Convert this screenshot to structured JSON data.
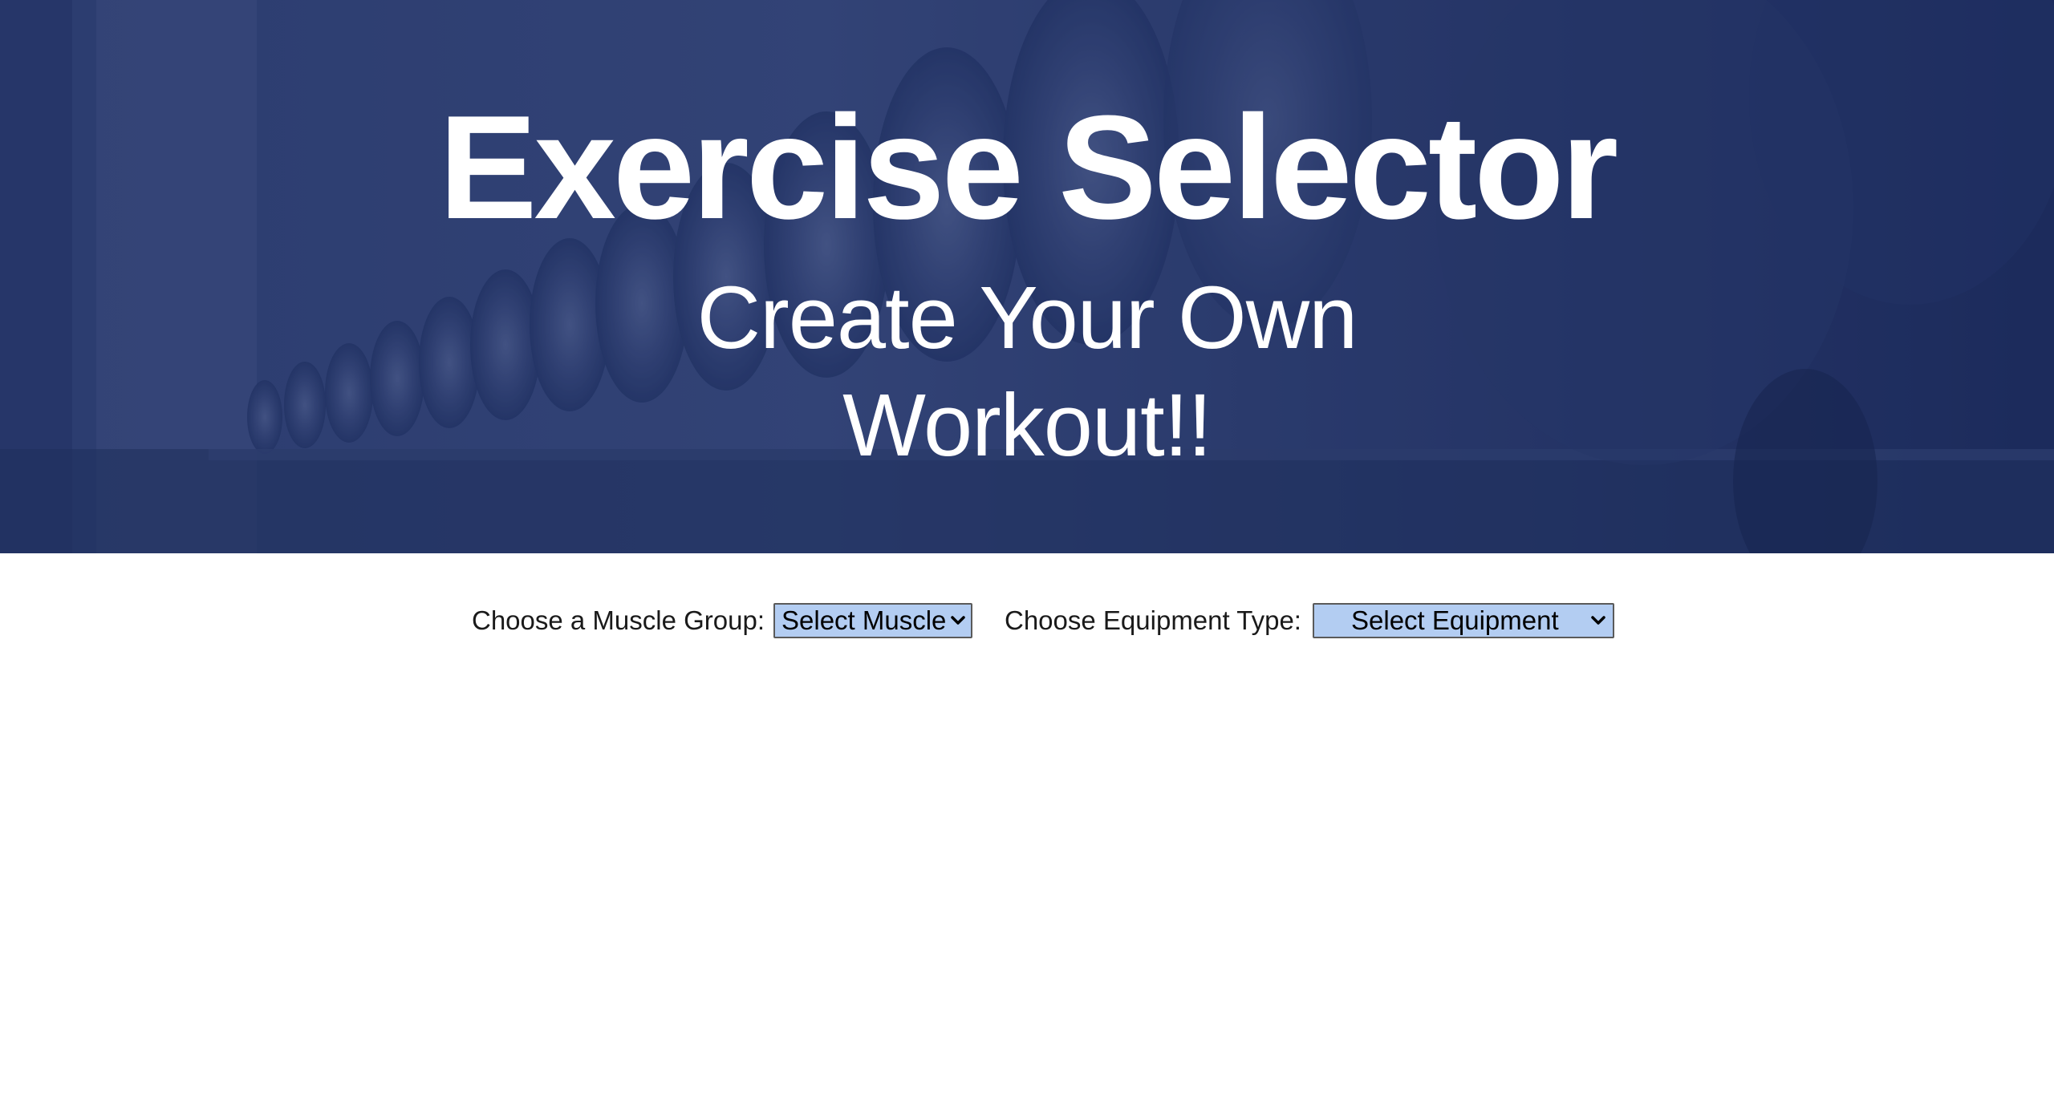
{
  "hero": {
    "title": "Exercise Selector",
    "subtitle": "Create Your Own Workout!!",
    "overlay_color": "#1c2b5c",
    "background_image": "gym-dumbbell-rack"
  },
  "controls": {
    "muscle_label": "Choose a Muscle Group:",
    "muscle_select_value": "Select Muscle",
    "equipment_label": "Choose Equipment Type:",
    "equipment_select_value": "Select Equipment",
    "select_bg_color": "#b3cdf2",
    "dropdown_icon": "chevron-down-icon"
  }
}
